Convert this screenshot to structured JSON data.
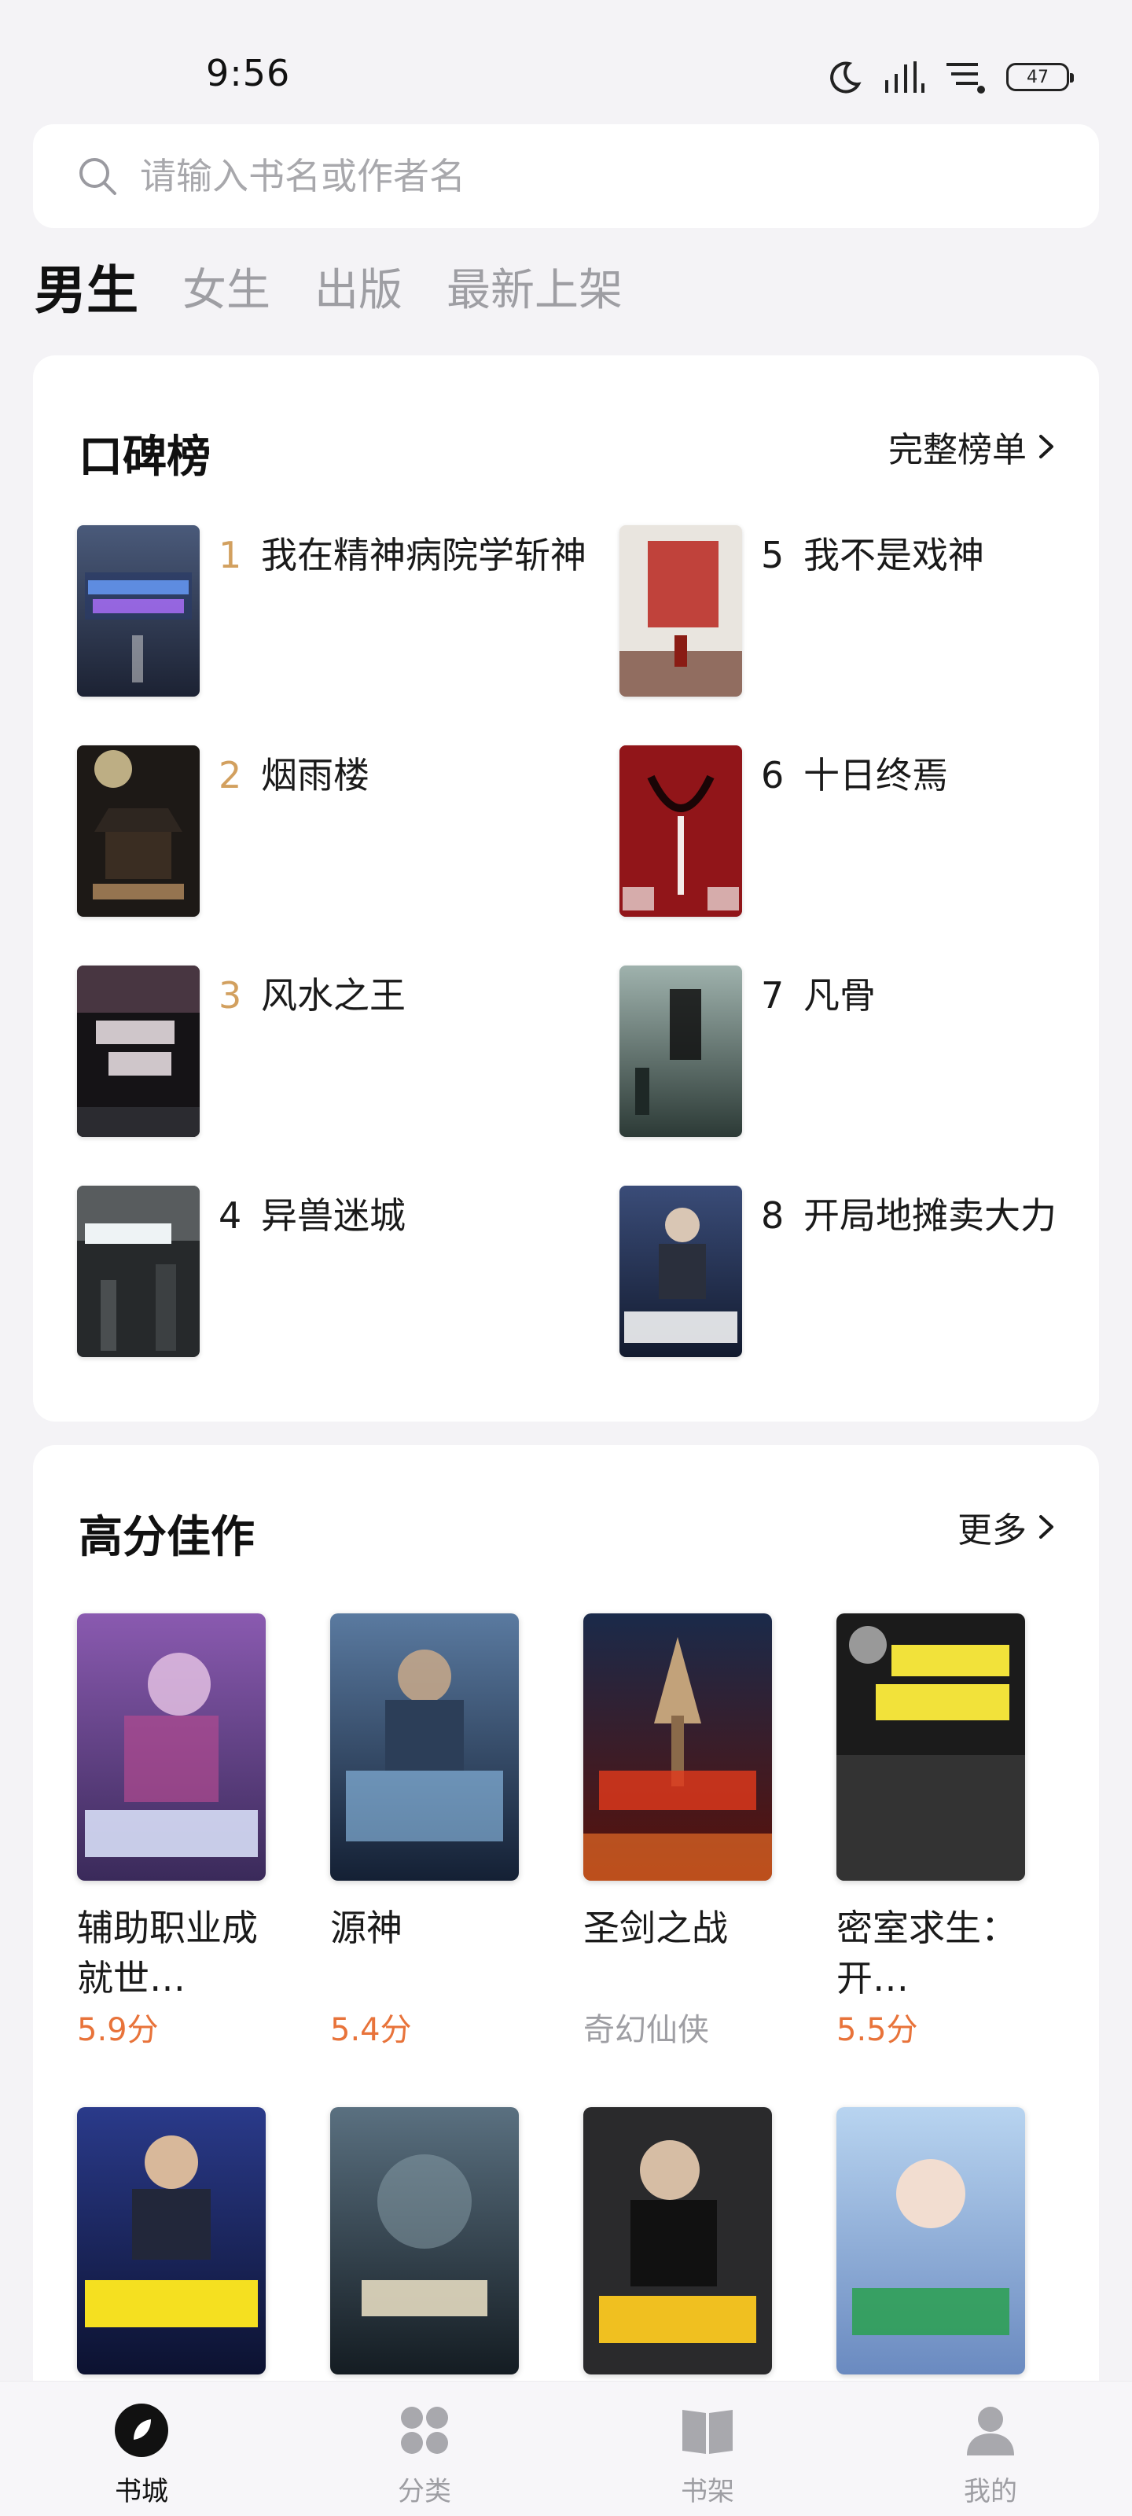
{
  "status": {
    "time": "9:56",
    "battery": "47"
  },
  "search": {
    "placeholder": "请输入书名或作者名"
  },
  "tabs": [
    {
      "label": "男生",
      "active": true
    },
    {
      "label": "女生",
      "active": false
    },
    {
      "label": "出版",
      "active": false
    },
    {
      "label": "最新上架",
      "active": false
    }
  ],
  "ranking": {
    "title": "口碑榜",
    "more": "完整榜单",
    "items": [
      {
        "rank": "1",
        "title": "我在精神病院学斩神"
      },
      {
        "rank": "2",
        "title": "烟雨楼"
      },
      {
        "rank": "3",
        "title": "风水之王"
      },
      {
        "rank": "4",
        "title": "异兽迷城"
      },
      {
        "rank": "5",
        "title": "我不是戏神"
      },
      {
        "rank": "6",
        "title": "十日终焉"
      },
      {
        "rank": "7",
        "title": "凡骨"
      },
      {
        "rank": "8",
        "title": "开局地摊卖大力"
      }
    ]
  },
  "high_score": {
    "title": "高分佳作",
    "more": "更多",
    "items": [
      {
        "title": "辅助职业成就世…",
        "meta": "5.9分",
        "meta_type": "score"
      },
      {
        "title": "源神",
        "meta": "5.4分",
        "meta_type": "score"
      },
      {
        "title": "圣剑之战",
        "meta": "奇幻仙侠",
        "meta_type": "genre"
      },
      {
        "title": "密室求生：开…",
        "meta": "5.5分",
        "meta_type": "score"
      }
    ]
  },
  "nav": [
    {
      "label": "书城",
      "active": true
    },
    {
      "label": "分类",
      "active": false
    },
    {
      "label": "书架",
      "active": false
    },
    {
      "label": "我的",
      "active": false
    }
  ]
}
